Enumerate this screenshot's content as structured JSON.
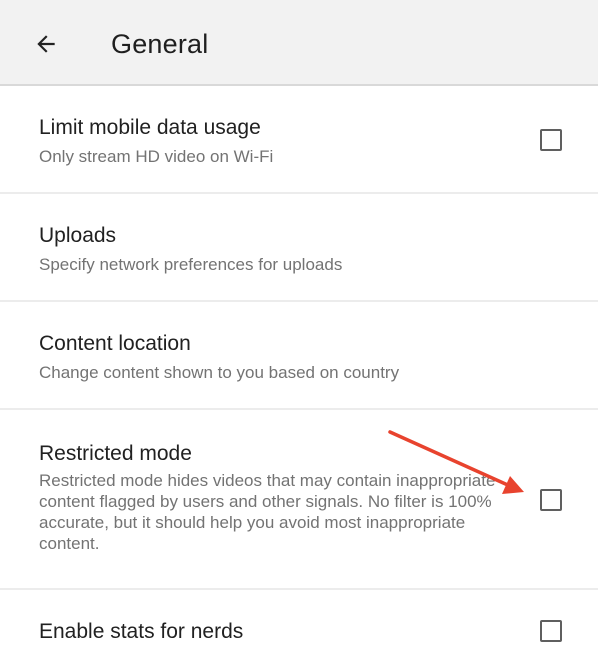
{
  "header": {
    "title": "General",
    "back_icon": "arrow-back-icon"
  },
  "settings": [
    {
      "title": "Limit mobile data usage",
      "subtitle": "Only stream HD video on Wi-Fi",
      "control": "checkbox",
      "checked": false
    },
    {
      "title": "Uploads",
      "subtitle": "Specify network preferences for uploads"
    },
    {
      "title": "Content location",
      "subtitle": "Change content shown to you based on country"
    },
    {
      "title": "Restricted mode",
      "subtitle": "Restricted mode hides videos that may contain inappropriate content flagged by users and other signals. No filter is 100%  accurate, but it should help you avoid most inappropriate content.",
      "control": "checkbox",
      "checked": false
    },
    {
      "title": "Enable stats for nerds",
      "control": "checkbox",
      "checked": false
    }
  ],
  "annotation": {
    "arrow_color": "#e8432e"
  }
}
